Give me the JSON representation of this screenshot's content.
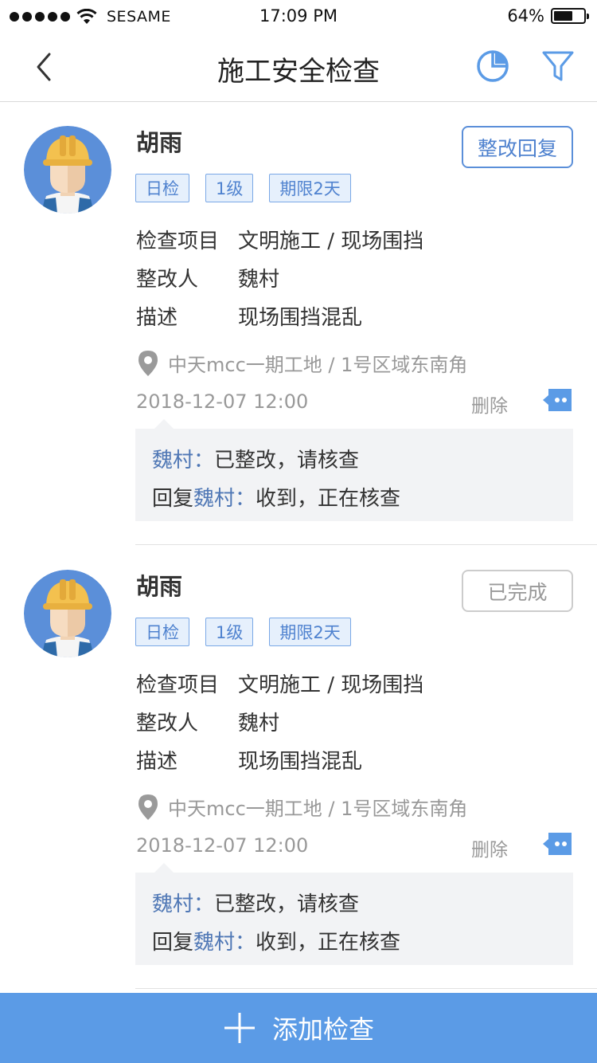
{
  "status_bar": {
    "carrier": "SESAME",
    "time": "17:09 PM",
    "battery": "64%",
    "battery_level": 0.64
  },
  "nav": {
    "title": "施工安全检查",
    "icons": [
      "back-arrow-icon",
      "pie-chart-icon",
      "filter-icon"
    ]
  },
  "colors": {
    "accent": "#5b9be6",
    "tag_bg": "#e6f0fc",
    "tag_text": "#4f82cf",
    "reply_bg": "#f2f3f5"
  },
  "cards": [
    {
      "name": "胡雨",
      "action": "整改回复",
      "action_style": "blue",
      "tags": [
        "日检",
        "1级",
        "期限2天"
      ],
      "fields": [
        {
          "label": "检查项目",
          "value": "文明施工 / 现场围挡"
        },
        {
          "label": "整改人",
          "value": "魏村"
        },
        {
          "label": "描述",
          "value": "现场围挡混乱"
        }
      ],
      "location": "中天mcc一期工地 / 1号区域东南角",
      "date": "2018-12-07 12:00",
      "delete": "删除",
      "replies": [
        {
          "prefix": "",
          "who": "魏村：",
          "text": "已整改，请核查"
        },
        {
          "prefix": "回复",
          "who": "魏村：",
          "text": "收到，正在核查"
        }
      ]
    },
    {
      "name": "胡雨",
      "action": "已完成",
      "action_style": "gray",
      "tags": [
        "日检",
        "1级",
        "期限2天"
      ],
      "fields": [
        {
          "label": "检查项目",
          "value": "文明施工 / 现场围挡"
        },
        {
          "label": "整改人",
          "value": "魏村"
        },
        {
          "label": "描述",
          "value": "现场围挡混乱"
        }
      ],
      "location": "中天mcc一期工地 / 1号区域东南角",
      "date": "2018-12-07 12:00",
      "delete": "删除",
      "replies": [
        {
          "prefix": "",
          "who": "魏村：",
          "text": "已整改，请核查"
        },
        {
          "prefix": "回复",
          "who": "魏村：",
          "text": "收到，正在核查"
        }
      ]
    }
  ],
  "add_button": {
    "label": "添加检查",
    "icon": "plus-icon"
  }
}
